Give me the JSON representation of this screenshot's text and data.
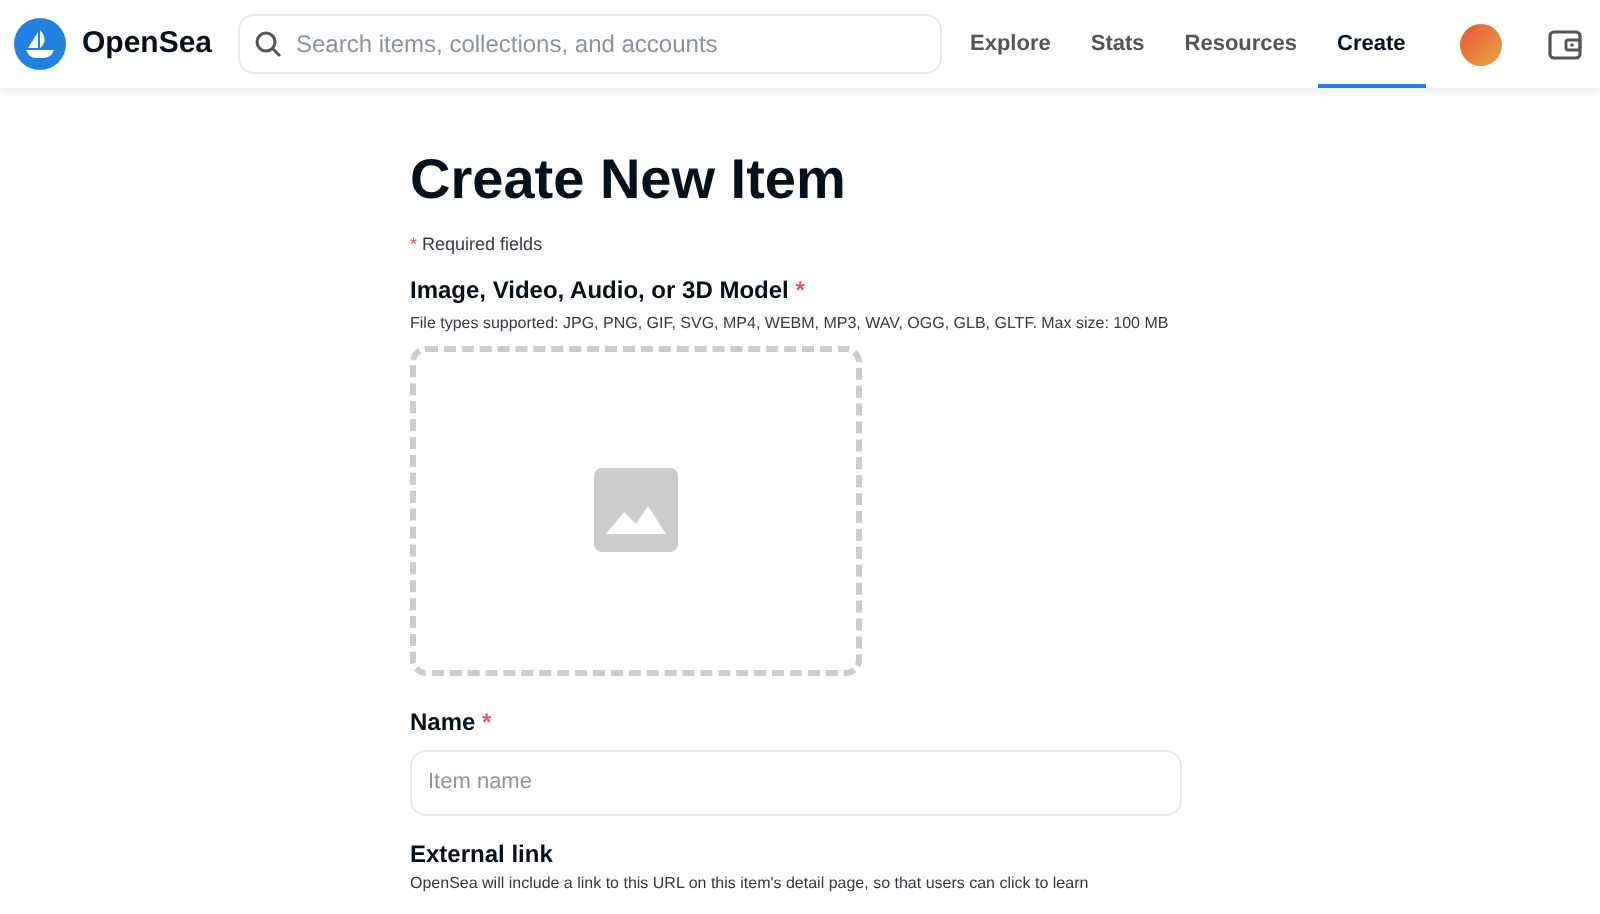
{
  "header": {
    "brand": "OpenSea",
    "search": {
      "placeholder": "Search items, collections, and accounts"
    },
    "nav": [
      {
        "label": "Explore",
        "selected": false
      },
      {
        "label": "Stats",
        "selected": false
      },
      {
        "label": "Resources",
        "selected": false
      },
      {
        "label": "Create",
        "selected": true
      }
    ]
  },
  "page": {
    "title": "Create New Item",
    "required_note": {
      "mark": "*",
      "text": "Required fields"
    },
    "media": {
      "label": "Image, Video, Audio, or 3D Model",
      "required_mark": "*",
      "hint": "File types supported: JPG, PNG, GIF, SVG, MP4, WEBM, MP3, WAV, OGG, GLB, GLTF. Max size: 100 MB"
    },
    "name": {
      "label": "Name",
      "required_mark": "*",
      "placeholder": "Item name"
    },
    "external_link": {
      "label": "External link",
      "hint": "OpenSea will include a link to this URL on this item's detail page, so that users can click to learn"
    }
  }
}
